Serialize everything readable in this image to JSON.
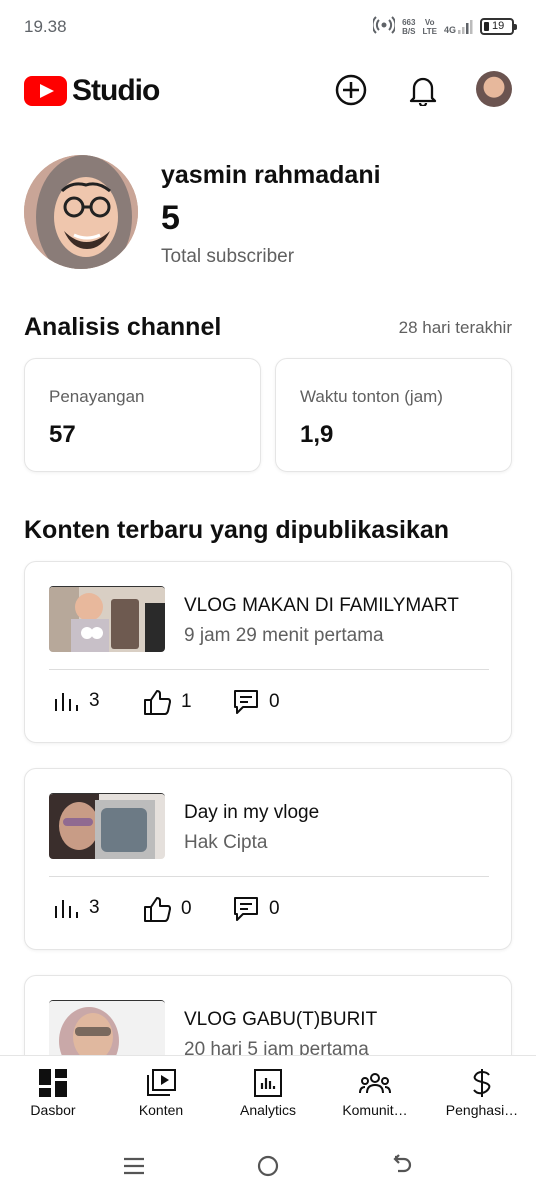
{
  "status_bar": {
    "time": "19.38",
    "net_speed_value": "663",
    "net_speed_unit": "B/S",
    "volte_top": "Vo",
    "volte_bottom": "LTE",
    "network": "4G",
    "battery": "19"
  },
  "header": {
    "brand": "Studio",
    "create_icon": "plus-circle-icon",
    "notification_icon": "bell-icon",
    "brand_color": "#ff0000"
  },
  "channel": {
    "name": "yasmin rahmadani",
    "subscribers": "5",
    "subscribers_label": "Total subscriber"
  },
  "analytics": {
    "title": "Analisis channel",
    "period": "28 hari terakhir",
    "stats": [
      {
        "label": "Penayangan",
        "value": "57"
      },
      {
        "label": "Waktu tonton (jam)",
        "value": "1,9"
      }
    ]
  },
  "recent": {
    "title": "Konten terbaru yang dipublikasikan",
    "videos": [
      {
        "title": "VLOG MAKAN DI FAMILYMART",
        "subtitle": "9 jam 29 menit pertama",
        "views": "3",
        "likes": "1",
        "comments": "0"
      },
      {
        "title": "Day in my vloge",
        "subtitle": "Hak Cipta",
        "views": "3",
        "likes": "0",
        "comments": "0"
      },
      {
        "title": "VLOG GABU(T)BURIT",
        "subtitle": "20 hari 5 jam pertama"
      }
    ]
  },
  "bottom_nav": [
    {
      "label": "Dasbor",
      "icon": "dashboard-icon"
    },
    {
      "label": "Konten",
      "icon": "content-icon"
    },
    {
      "label": "Analytics",
      "icon": "analytics-icon"
    },
    {
      "label": "Komunit…",
      "icon": "community-icon"
    },
    {
      "label": "Penghasi…",
      "icon": "dollar-icon"
    }
  ]
}
